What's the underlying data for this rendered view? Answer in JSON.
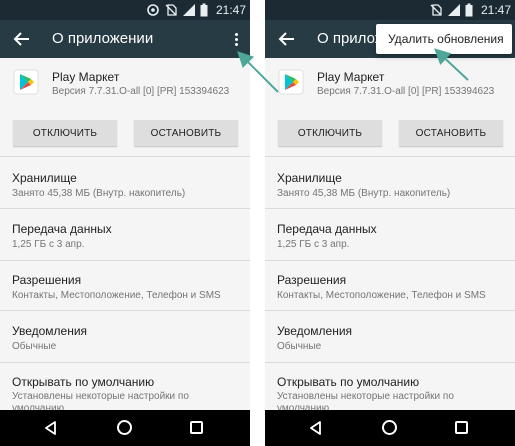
{
  "status": {
    "time": "21:47"
  },
  "appbar": {
    "title_left": "О приложении",
    "title_right": "О приложен"
  },
  "app": {
    "name": "Play Маркет",
    "version": "Версия 7.7.31.O-all [0] [PR] 153394623"
  },
  "buttons": {
    "disable": "ОТКЛЮЧИТЬ",
    "stop": "ОСТАНОВИТЬ"
  },
  "sections": [
    {
      "title": "Хранилище",
      "subtitle": "Занято 45,38 МБ (Внутр. накопитель)"
    },
    {
      "title": "Передача данных",
      "subtitle": "1,25 ГБ с 3 апр."
    },
    {
      "title": "Разрешения",
      "subtitle": "Контакты, Местоположение, Телефон и SMS"
    },
    {
      "title": "Уведомления",
      "subtitle": "Обычные"
    },
    {
      "title": "Открывать по умолчанию",
      "subtitle": "Установлены некоторые настройки по умолчанию"
    }
  ],
  "menu": {
    "uninstall_updates": "Удалить обновления"
  },
  "colors": {
    "statusbar": "#1c2b33",
    "appbar": "#263b44",
    "annotation_arrow": "#4fa79a",
    "button": "#dedede"
  },
  "icons": [
    "no-sim-icon",
    "battery-icon",
    "data-saver-icon",
    "signal-icon",
    "back-icon",
    "more-vert-icon",
    "play-store-icon",
    "nav-back-icon",
    "nav-home-icon",
    "nav-recents-icon"
  ]
}
